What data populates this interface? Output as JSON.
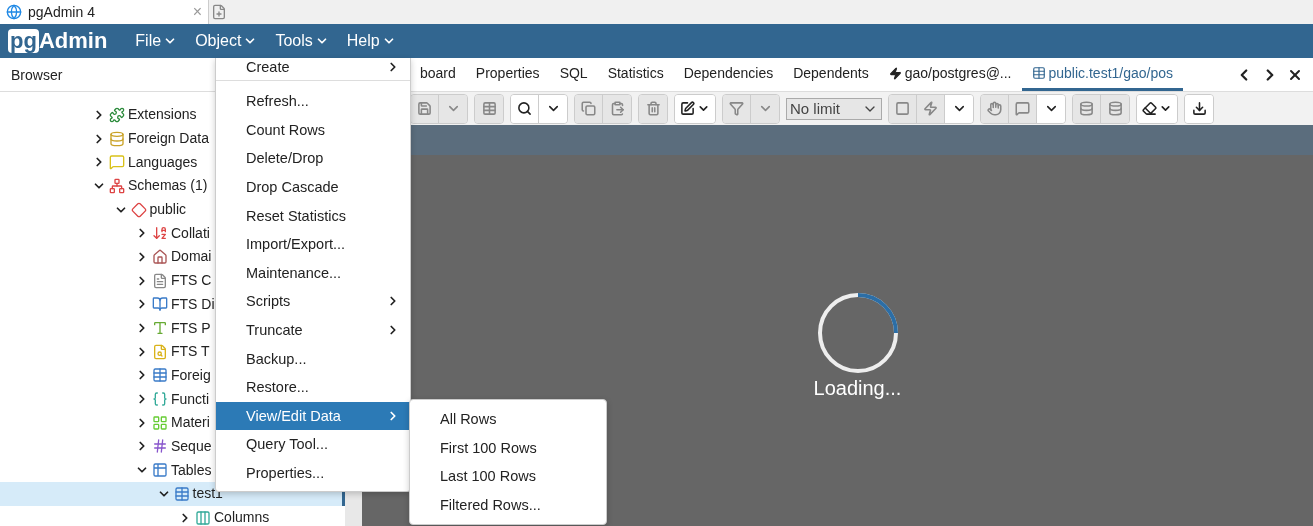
{
  "browser_tab": {
    "title": "pgAdmin 4",
    "close": "×"
  },
  "navbar": {
    "logo_prefix": "pg",
    "logo_name": "Admin",
    "menus": [
      {
        "label": "File"
      },
      {
        "label": "Object"
      },
      {
        "label": "Tools"
      },
      {
        "label": "Help"
      }
    ]
  },
  "browser_panel": {
    "title": "Browser"
  },
  "tree": [
    {
      "label": "Extensions",
      "kind": "extension",
      "expanded": false,
      "selected": false
    },
    {
      "label": "Foreign Data",
      "kind": "foreign",
      "expanded": false,
      "selected": false
    },
    {
      "label": "Languages",
      "kind": "language",
      "expanded": false,
      "selected": false
    },
    {
      "label": "Schemas (1)",
      "kind": "schemas",
      "expanded": true,
      "selected": false,
      "children": [
        {
          "label": "public",
          "kind": "schema",
          "expanded": true,
          "selected": false,
          "children": [
            {
              "label": "Collati",
              "kind": "collation",
              "expanded": false,
              "selected": false
            },
            {
              "label": "Domai",
              "kind": "domain",
              "expanded": false,
              "selected": false
            },
            {
              "label": "FTS C",
              "kind": "fts",
              "expanded": false,
              "selected": false
            },
            {
              "label": "FTS Di",
              "kind": "dictionary",
              "expanded": false,
              "selected": false
            },
            {
              "label": "FTS P",
              "kind": "parser",
              "expanded": false,
              "selected": false
            },
            {
              "label": "FTS T",
              "kind": "template",
              "expanded": false,
              "selected": false
            },
            {
              "label": "Foreig",
              "kind": "foreign_table",
              "expanded": false,
              "selected": false
            },
            {
              "label": "Functi",
              "kind": "function",
              "expanded": false,
              "selected": false
            },
            {
              "label": "Materi",
              "kind": "matview",
              "expanded": false,
              "selected": false
            },
            {
              "label": "Seque",
              "kind": "sequence",
              "expanded": false,
              "selected": false
            },
            {
              "label": "Tables",
              "kind": "tables",
              "expanded": true,
              "selected": false,
              "children": [
                {
                  "label": "test1",
                  "kind": "table",
                  "expanded": true,
                  "selected": true,
                  "children": [
                    {
                      "label": "Columns",
                      "kind": "columns",
                      "expanded": false,
                      "selected": false
                    }
                  ]
                }
              ]
            }
          ]
        }
      ]
    }
  ],
  "tabs": [
    {
      "label": "board",
      "kind": "plain",
      "selected": false
    },
    {
      "label": "Properties",
      "kind": "plain",
      "selected": false
    },
    {
      "label": "SQL",
      "kind": "plain",
      "selected": false
    },
    {
      "label": "Statistics",
      "kind": "plain",
      "selected": false
    },
    {
      "label": "Dependencies",
      "kind": "plain",
      "selected": false
    },
    {
      "label": "Dependents",
      "kind": "plain",
      "selected": false
    },
    {
      "label": "gao/postgres@...",
      "kind": "query",
      "selected": false
    },
    {
      "label": "public.test1/gao/pos",
      "kind": "data",
      "selected": true
    }
  ],
  "toolbar": [
    [
      {
        "kind": "save",
        "disabled": true
      },
      {
        "kind": "caret",
        "disabled": true
      }
    ],
    [
      {
        "kind": "grid",
        "disabled": true
      }
    ],
    [
      {
        "kind": "search",
        "disabled": false
      },
      {
        "kind": "caret",
        "disabled": false
      }
    ],
    [
      {
        "kind": "copy",
        "disabled": true
      },
      {
        "kind": "paste",
        "disabled": true
      }
    ],
    [
      {
        "kind": "trash",
        "disabled": true
      }
    ],
    [
      {
        "kind": "edit",
        "disabled": false
      }
    ],
    [
      {
        "kind": "filter",
        "disabled": true
      },
      {
        "kind": "caret",
        "disabled": true
      }
    ],
    [
      {
        "kind": "limit",
        "value": "No limit",
        "disabled": true
      }
    ],
    [
      {
        "kind": "stop",
        "disabled": true
      },
      {
        "kind": "bolt",
        "disabled": true
      },
      {
        "kind": "caret",
        "disabled": false
      }
    ],
    [
      {
        "kind": "hand",
        "disabled": true
      },
      {
        "kind": "comment",
        "disabled": true
      },
      {
        "kind": "caret",
        "disabled": false
      }
    ],
    [
      {
        "kind": "commit",
        "disabled": true
      },
      {
        "kind": "rollback",
        "disabled": true
      }
    ],
    [
      {
        "kind": "eraser",
        "disabled": false
      }
    ],
    [
      {
        "kind": "download",
        "disabled": false
      }
    ]
  ],
  "loading": {
    "text": "Loading..."
  },
  "object_menu": [
    {
      "label": "Create",
      "submenu": true,
      "selected": false
    },
    {
      "label": "Refresh...",
      "submenu": false,
      "selected": false
    },
    {
      "label": "Count Rows",
      "submenu": false,
      "selected": false
    },
    {
      "label": "Delete/Drop",
      "submenu": false,
      "selected": false
    },
    {
      "label": "Drop Cascade",
      "submenu": false,
      "selected": false
    },
    {
      "label": "Reset Statistics",
      "submenu": false,
      "selected": false
    },
    {
      "label": "Import/Export...",
      "submenu": false,
      "selected": false
    },
    {
      "label": "Maintenance...",
      "submenu": false,
      "selected": false
    },
    {
      "label": "Scripts",
      "submenu": true,
      "selected": false
    },
    {
      "label": "Truncate",
      "submenu": true,
      "selected": false
    },
    {
      "label": "Backup...",
      "submenu": false,
      "selected": false
    },
    {
      "label": "Restore...",
      "submenu": false,
      "selected": false
    },
    {
      "label": "View/Edit Data",
      "submenu": true,
      "selected": true
    },
    {
      "label": "Query Tool...",
      "submenu": false,
      "selected": false
    },
    {
      "label": "Properties...",
      "submenu": false,
      "selected": false
    }
  ],
  "submenu": [
    {
      "label": "All Rows"
    },
    {
      "label": "First 100 Rows"
    },
    {
      "label": "Last 100 Rows"
    },
    {
      "label": "Filtered Rows..."
    }
  ]
}
